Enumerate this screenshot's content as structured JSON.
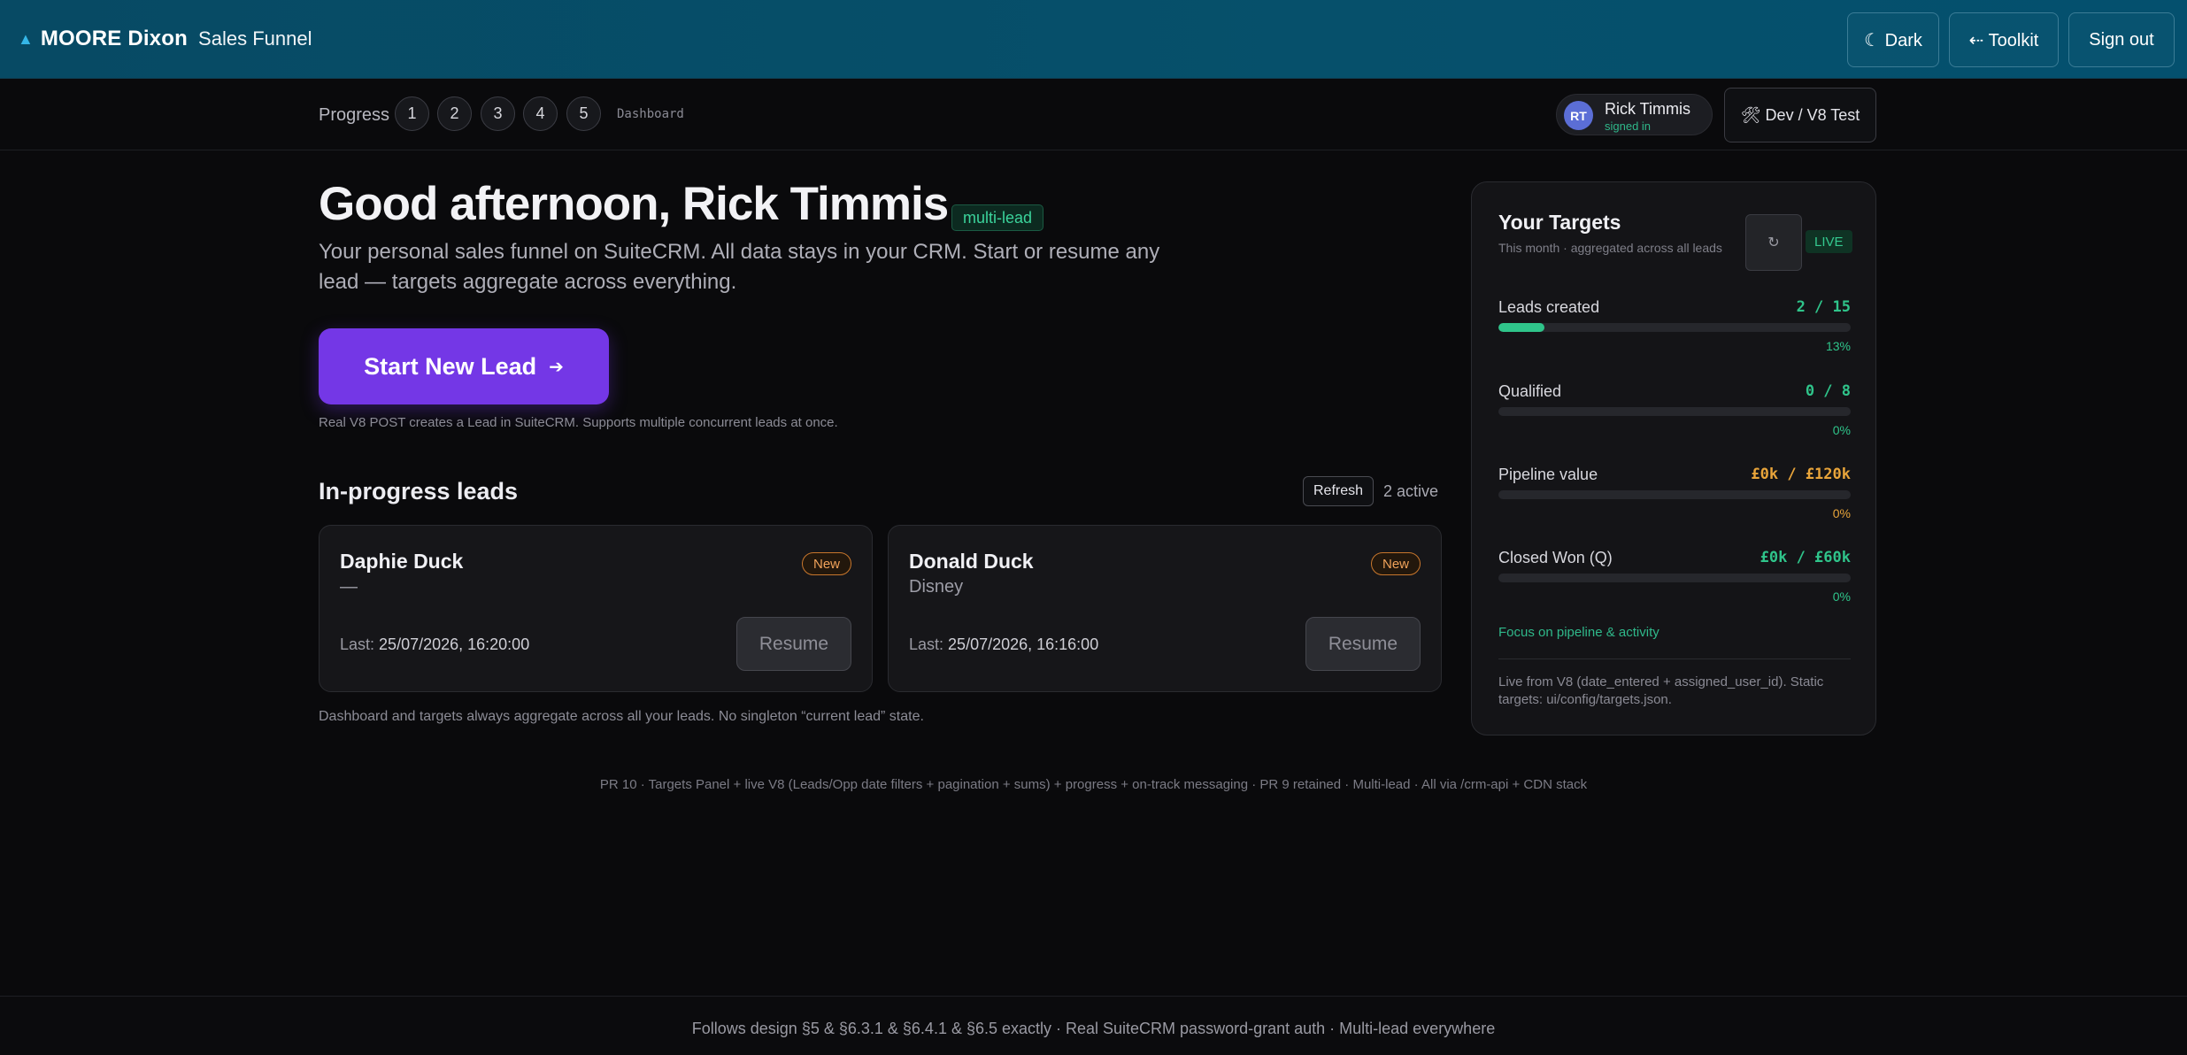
{
  "header": {
    "brand": "MOORE Dixon",
    "app_name": "Sales Funnel",
    "dark_label": "☾  Dark",
    "toolkit_label": "⇠ Toolkit",
    "signout_label": "Sign out"
  },
  "progress": {
    "label": "Progress",
    "steps": [
      "1",
      "2",
      "3",
      "4",
      "5"
    ],
    "current_page": "Dashboard"
  },
  "user": {
    "initials": "RT",
    "name": "Rick Timmis",
    "status": "signed in"
  },
  "env_label": "🛠  Dev / V8 Test",
  "main": {
    "greeting": "Good afternoon, Rick Timmis",
    "mode_badge": "multi-lead",
    "subtitle": "Your personal sales funnel on SuiteCRM. All data stays in your CRM. Start or resume any lead — targets aggregate across everything.",
    "cta_label": "Start New Lead",
    "cta_arrow": "➔",
    "cta_note": "Real V8 POST creates a Lead in SuiteCRM. Supports multiple concurrent leads at once.",
    "section_title": "In-progress leads",
    "refresh_label": "Refresh",
    "active_count": "2 active",
    "leads": [
      {
        "name": "Daphie Duck",
        "company": "—",
        "status": "New",
        "last_label": "Last:",
        "last_value": "25/07/2026, 16:20:00",
        "resume_label": "Resume"
      },
      {
        "name": "Donald Duck",
        "company": "Disney",
        "status": "New",
        "last_label": "Last:",
        "last_value": "25/07/2026, 16:16:00",
        "resume_label": "Resume"
      }
    ],
    "list_note": "Dashboard and targets always aggregate across all your leads. No singleton “current lead” state.",
    "pr_note": "PR 10 · Targets Panel + live V8 (Leads/Opp date filters + pagination + sums) + progress + on-track messaging · PR 9 retained · Multi-lead · All via /crm-api + CDN stack"
  },
  "targets": {
    "title": "Your Targets",
    "subtitle": "This month · aggregated across all leads",
    "refresh_icon": "↻",
    "live_badge": "LIVE",
    "metrics": [
      {
        "label": "Leads created",
        "value": "2 / 15",
        "progress": 0.13,
        "pct": "13%",
        "color": "#2fc48a"
      },
      {
        "label": "Qualified",
        "value": "0 / 8",
        "progress": 0,
        "pct": "0%",
        "color": "#2fc48a"
      },
      {
        "label": "Pipeline value",
        "value": "£0k / £120k",
        "progress": 0,
        "pct": "0%",
        "color": "#e8a43a"
      },
      {
        "label": "Closed Won (Q)",
        "value": "£0k / £60k",
        "progress": 0,
        "pct": "0%",
        "color": "#2fc48a"
      }
    ],
    "focus": "Focus on pipeline & activity",
    "footnote": "Live from V8 (date_entered + assigned_user_id). Static targets: ui/config/targets.json."
  },
  "footer": {
    "text": "Follows design §5 & §6.3.1 & §6.4.1 & §6.5 exactly · Real SuiteCRM password-grant auth · Multi-lead everywhere"
  },
  "colors": {
    "accent": "#7437e6",
    "success": "#2fc48a",
    "warning": "#e8a43a",
    "header_bg": "#06506b"
  }
}
